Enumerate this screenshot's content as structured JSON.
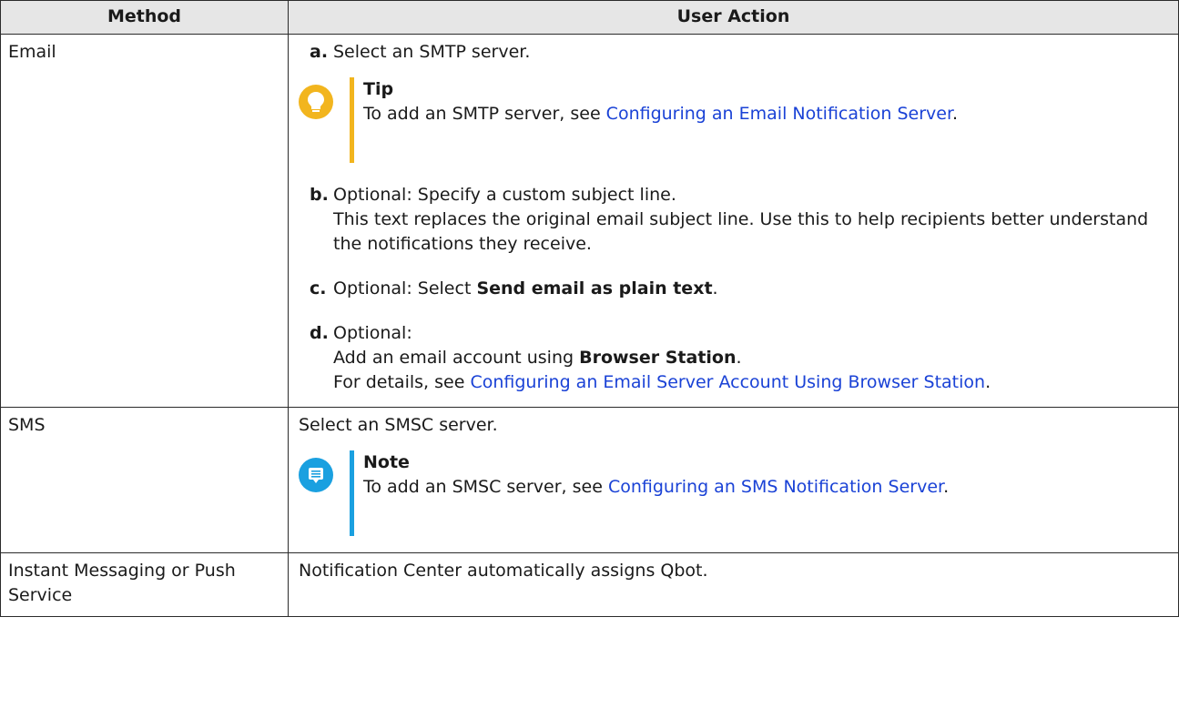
{
  "headers": {
    "method": "Method",
    "action": "User Action"
  },
  "email": {
    "method": "Email",
    "a_num": "a.",
    "a_text": "Select an SMTP server.",
    "tip_title": "Tip",
    "tip_pre": "To add an SMTP server, see ",
    "tip_link": "Configuring an Email Notification Server",
    "tip_post": ".",
    "b_num": "b.",
    "b_text": "Optional: Specify a custom subject line.",
    "b_desc": "This text replaces the original email subject line. Use this to help recipients better understand the notifications they receive.",
    "c_num": "c.",
    "c_pre": "Optional: Select ",
    "c_bold": "Send email as plain text",
    "c_post": ".",
    "d_num": "d.",
    "d_text": "Optional:",
    "d_line2_pre": "Add an email account using ",
    "d_line2_bold": "Browser Station",
    "d_line2_post": ".",
    "d_line3_pre": "For details, see ",
    "d_line3_link": "Configuring an Email Server Account Using Browser Station",
    "d_line3_post": "."
  },
  "sms": {
    "method": "SMS",
    "text": "Select an SMSC server.",
    "note_title": "Note",
    "note_pre": "To add an SMSC server, see ",
    "note_link": "Configuring an SMS Notification Server",
    "note_post": "."
  },
  "im": {
    "method": "Instant Messaging or Push Service",
    "text": "Notification Center automatically assigns Qbot."
  },
  "colors": {
    "tip": "#f2b51e",
    "note": "#1aa0e0",
    "link": "#1a42d6",
    "header_bg": "#e6e6e6"
  },
  "icons": {
    "tip": "lightbulb-icon",
    "note": "message-icon"
  }
}
